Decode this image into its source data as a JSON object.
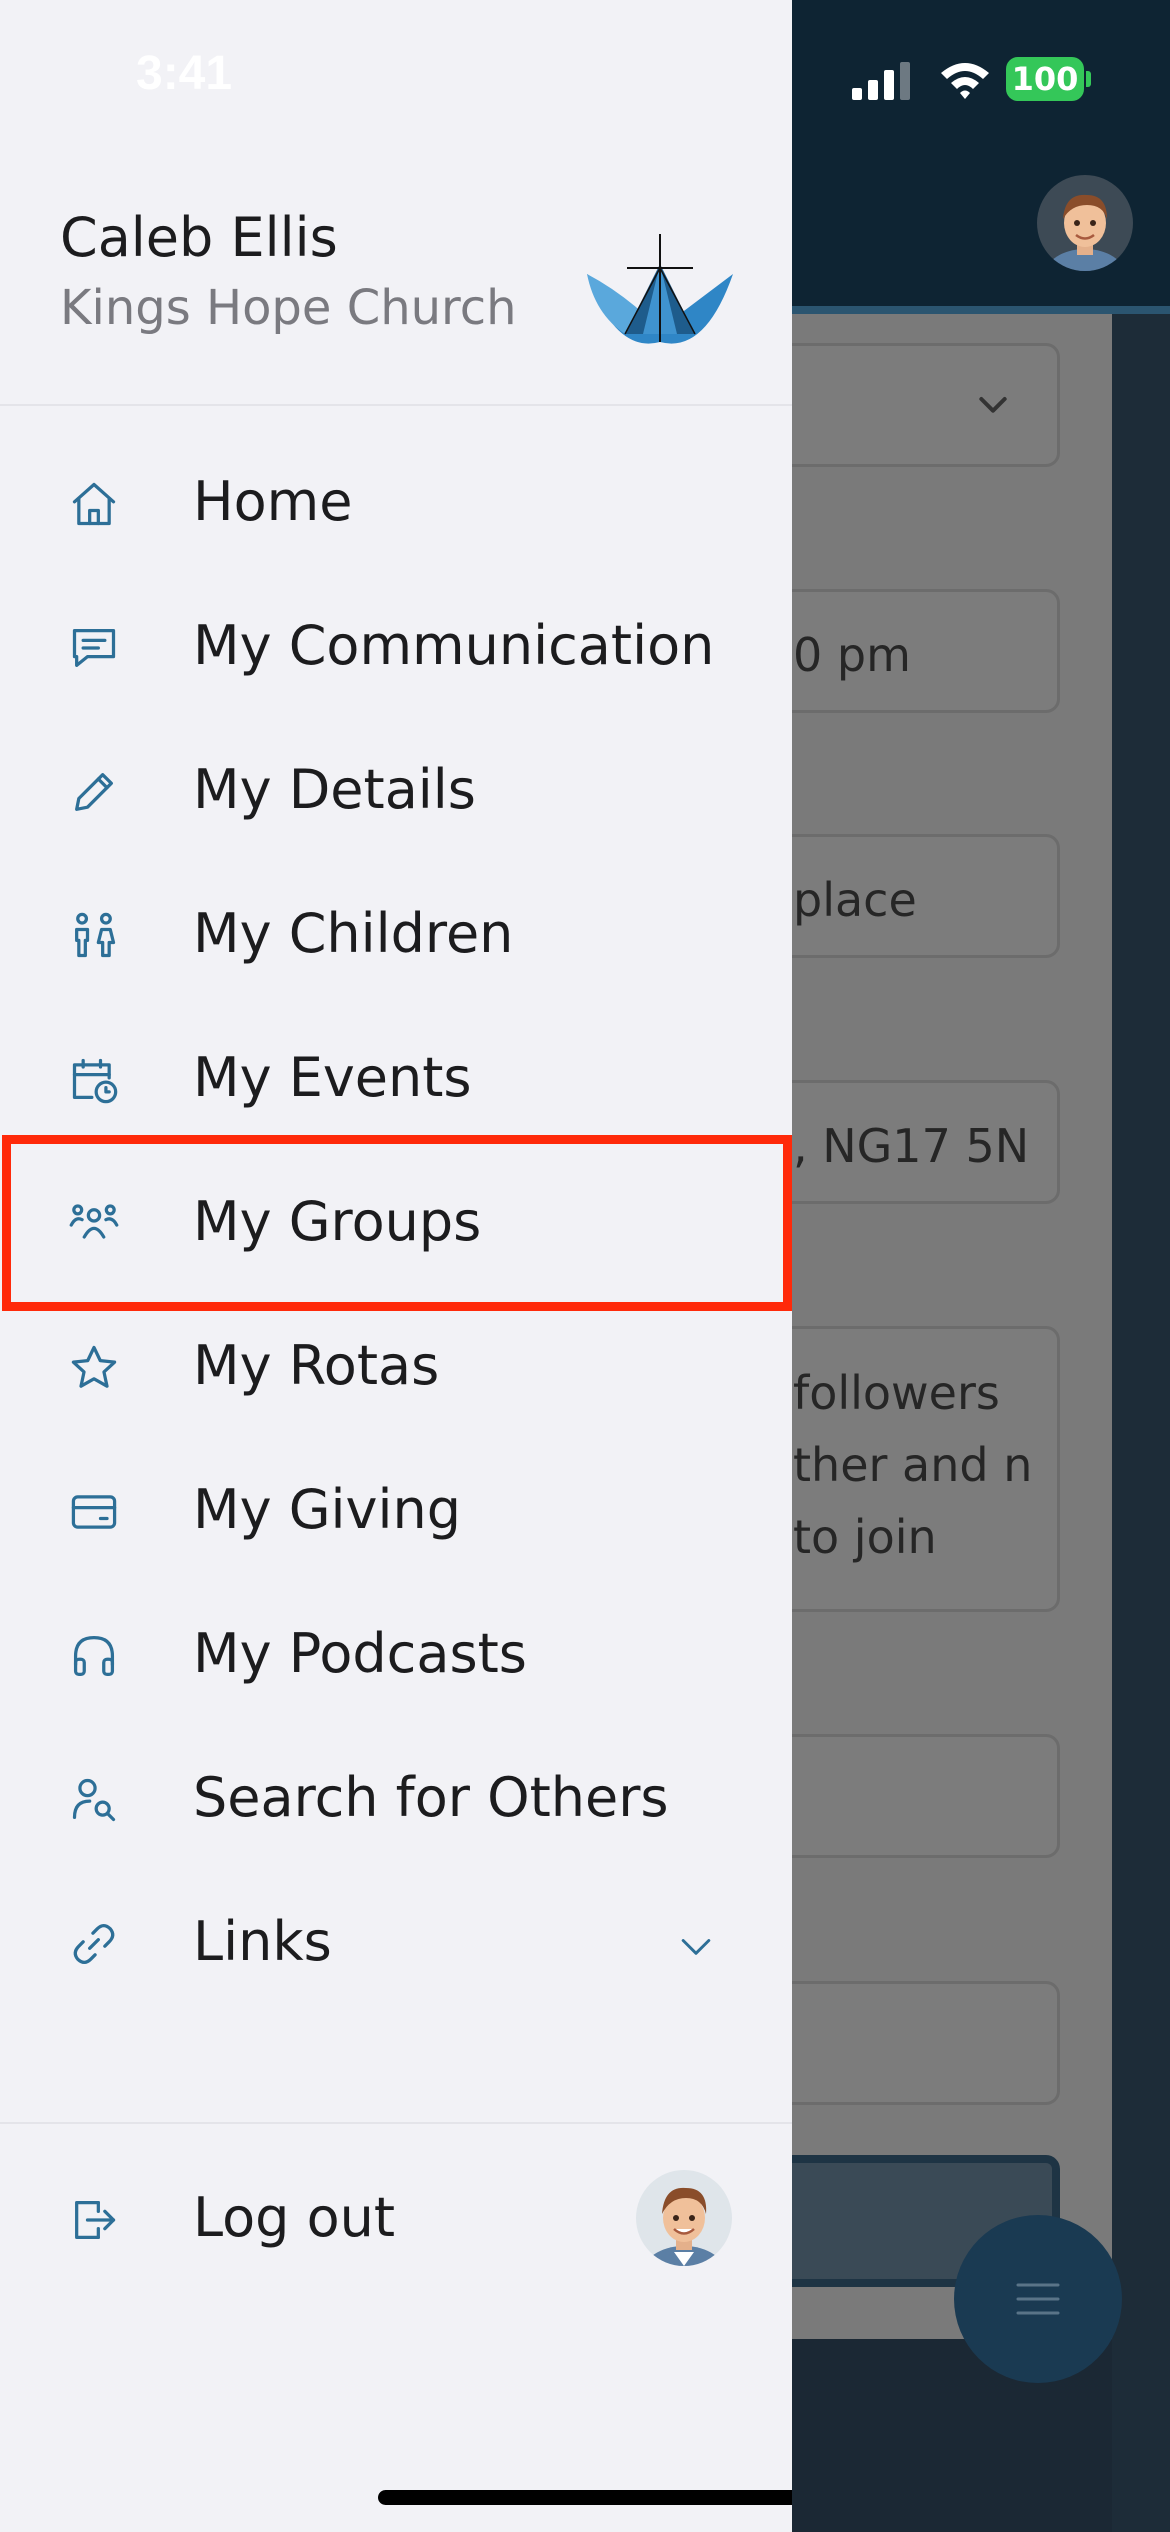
{
  "status_bar": {
    "time": "3:41",
    "battery": "100"
  },
  "background": {
    "field_1_text": "",
    "field_2_text": "0 pm",
    "field_3_text": "place",
    "field_4_text": ", NG17 5N",
    "field_5_text": "followers ther and n  to join",
    "field_6_text": "",
    "field_7_text": ""
  },
  "drawer": {
    "profile": {
      "name": "Caleb Ellis",
      "church": "Kings Hope Church"
    },
    "menu": [
      {
        "label": "Home",
        "icon": "home-icon"
      },
      {
        "label": "My Communication",
        "icon": "chat-icon"
      },
      {
        "label": "My Details",
        "icon": "pencil-icon"
      },
      {
        "label": "My Children",
        "icon": "children-icon"
      },
      {
        "label": "My Events",
        "icon": "calendar-clock-icon"
      },
      {
        "label": "My Groups",
        "icon": "group-icon"
      },
      {
        "label": "My Rotas",
        "icon": "star-icon"
      },
      {
        "label": "My Giving",
        "icon": "card-icon"
      },
      {
        "label": "My Podcasts",
        "icon": "headphones-icon"
      },
      {
        "label": "Search for Others",
        "icon": "person-search-icon"
      },
      {
        "label": "Links",
        "icon": "link-icon"
      }
    ],
    "logout_label": "Log out"
  },
  "colors": {
    "accent": "#2d6f97",
    "highlight": "#ff2a0a",
    "drawer_bg": "#f2f2f6"
  }
}
